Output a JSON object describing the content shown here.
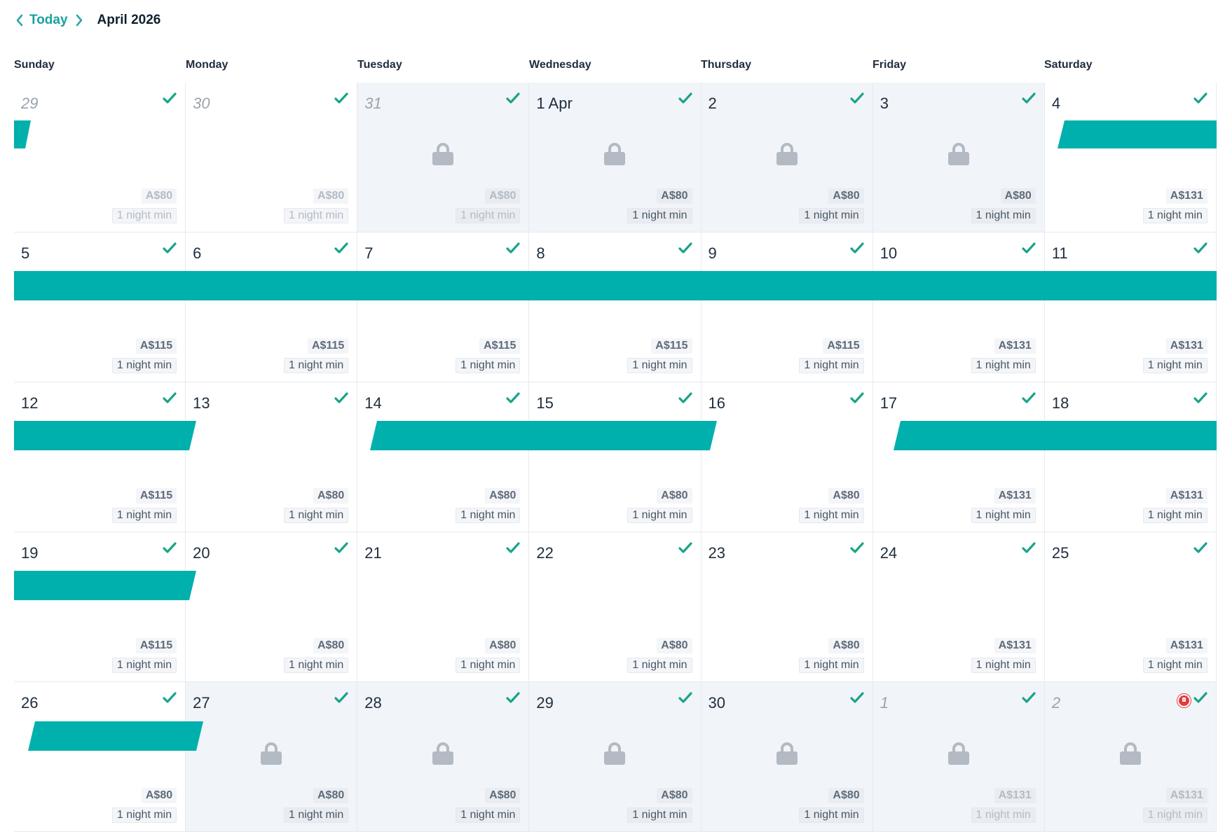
{
  "header": {
    "today_label": "Today",
    "month_label": "April 2026"
  },
  "weekdays": [
    "Sunday",
    "Monday",
    "Tuesday",
    "Wednesday",
    "Thursday",
    "Friday",
    "Saturday"
  ],
  "colors": {
    "booking_bar": "#00b0ad",
    "check": "#1aa38a",
    "blocked_bg": "#f1f4f8",
    "alert": "#e23b3b"
  },
  "weeks": [
    [
      {
        "day": "29",
        "other": true,
        "price": "A$80",
        "min": "1 night min",
        "locked": false,
        "faded": true
      },
      {
        "day": "30",
        "other": true,
        "price": "A$80",
        "min": "1 night min",
        "locked": false,
        "faded": true
      },
      {
        "day": "31",
        "other": true,
        "price": "A$80",
        "min": "1 night min",
        "locked": true,
        "faded": true
      },
      {
        "day": "1 Apr",
        "other": false,
        "price": "A$80",
        "min": "1 night min",
        "locked": true,
        "faded": false
      },
      {
        "day": "2",
        "other": false,
        "price": "A$80",
        "min": "1 night min",
        "locked": true,
        "faded": false
      },
      {
        "day": "3",
        "other": false,
        "price": "A$80",
        "min": "1 night min",
        "locked": true,
        "faded": false
      },
      {
        "day": "4",
        "other": false,
        "price": "A$131",
        "min": "1 night min",
        "locked": false,
        "faded": false
      }
    ],
    [
      {
        "day": "5",
        "other": false,
        "price": "A$115",
        "min": "1 night min",
        "locked": false,
        "faded": false
      },
      {
        "day": "6",
        "other": false,
        "price": "A$115",
        "min": "1 night min",
        "locked": false,
        "faded": false
      },
      {
        "day": "7",
        "other": false,
        "price": "A$115",
        "min": "1 night min",
        "locked": false,
        "faded": false
      },
      {
        "day": "8",
        "other": false,
        "price": "A$115",
        "min": "1 night min",
        "locked": false,
        "faded": false
      },
      {
        "day": "9",
        "other": false,
        "price": "A$115",
        "min": "1 night min",
        "locked": false,
        "faded": false
      },
      {
        "day": "10",
        "other": false,
        "price": "A$131",
        "min": "1 night min",
        "locked": false,
        "faded": false
      },
      {
        "day": "11",
        "other": false,
        "price": "A$131",
        "min": "1 night min",
        "locked": false,
        "faded": false
      }
    ],
    [
      {
        "day": "12",
        "other": false,
        "price": "A$115",
        "min": "1 night min",
        "locked": false,
        "faded": false
      },
      {
        "day": "13",
        "other": false,
        "price": "A$80",
        "min": "1 night min",
        "locked": false,
        "faded": false
      },
      {
        "day": "14",
        "other": false,
        "price": "A$80",
        "min": "1 night min",
        "locked": false,
        "faded": false
      },
      {
        "day": "15",
        "other": false,
        "price": "A$80",
        "min": "1 night min",
        "locked": false,
        "faded": false
      },
      {
        "day": "16",
        "other": false,
        "price": "A$80",
        "min": "1 night min",
        "locked": false,
        "faded": false
      },
      {
        "day": "17",
        "other": false,
        "price": "A$131",
        "min": "1 night min",
        "locked": false,
        "faded": false
      },
      {
        "day": "18",
        "other": false,
        "price": "A$131",
        "min": "1 night min",
        "locked": false,
        "faded": false
      }
    ],
    [
      {
        "day": "19",
        "other": false,
        "price": "A$115",
        "min": "1 night min",
        "locked": false,
        "faded": false
      },
      {
        "day": "20",
        "other": false,
        "price": "A$80",
        "min": "1 night min",
        "locked": false,
        "faded": false
      },
      {
        "day": "21",
        "other": false,
        "price": "A$80",
        "min": "1 night min",
        "locked": false,
        "faded": false
      },
      {
        "day": "22",
        "other": false,
        "price": "A$80",
        "min": "1 night min",
        "locked": false,
        "faded": false
      },
      {
        "day": "23",
        "other": false,
        "price": "A$80",
        "min": "1 night min",
        "locked": false,
        "faded": false
      },
      {
        "day": "24",
        "other": false,
        "price": "A$131",
        "min": "1 night min",
        "locked": false,
        "faded": false
      },
      {
        "day": "25",
        "other": false,
        "price": "A$131",
        "min": "1 night min",
        "locked": false,
        "faded": false
      }
    ],
    [
      {
        "day": "26",
        "other": false,
        "price": "A$80",
        "min": "1 night min",
        "locked": false,
        "faded": false
      },
      {
        "day": "27",
        "other": false,
        "price": "A$80",
        "min": "1 night min",
        "locked": true,
        "faded": false
      },
      {
        "day": "28",
        "other": false,
        "price": "A$80",
        "min": "1 night min",
        "locked": true,
        "faded": false
      },
      {
        "day": "29",
        "other": false,
        "price": "A$80",
        "min": "1 night min",
        "locked": true,
        "faded": false
      },
      {
        "day": "30",
        "other": false,
        "price": "A$80",
        "min": "1 night min",
        "locked": true,
        "faded": false
      },
      {
        "day": "1",
        "other": true,
        "price": "A$131",
        "min": "1 night min",
        "locked": true,
        "faded": true
      },
      {
        "day": "2",
        "other": true,
        "price": "A$131",
        "min": "1 night min",
        "locked": true,
        "faded": true,
        "alert": true
      }
    ]
  ]
}
